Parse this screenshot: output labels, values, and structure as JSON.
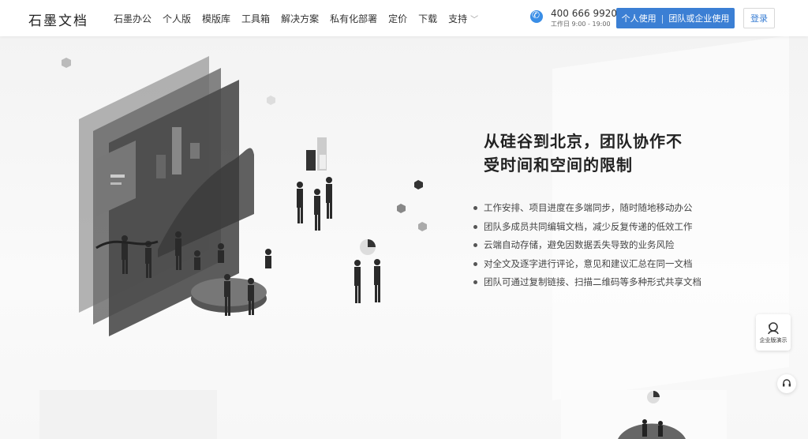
{
  "header": {
    "logo": "石墨文档",
    "nav": [
      {
        "label": "石墨办公"
      },
      {
        "label": "个人版"
      },
      {
        "label": "模版库"
      },
      {
        "label": "工具箱"
      },
      {
        "label": "解决方案"
      },
      {
        "label": "私有化部署"
      },
      {
        "label": "定价"
      },
      {
        "label": "下载"
      },
      {
        "label": "支持"
      }
    ],
    "phone": "400 666 9920",
    "hours": "工作日 9:00 - 19:00",
    "cta_personal": "个人使用",
    "cta_team": "团队或企业使用",
    "login": "登录"
  },
  "hero": {
    "headline_line1": "从硅谷到北京，团队协作不",
    "headline_line2": "受时间和空间的限制",
    "features": [
      "工作安排、项目进度在多端同步，随时随地移动办公",
      "团队多成员共同编辑文档，减少反复传递的低效工作",
      "云端自动存储，避免因数据丢失导致的业务风险",
      "对全文及逐字进行评论，意见和建议汇总在同一文档",
      "团队可通过复制链接、扫描二维码等多种形式共享文档"
    ]
  },
  "floating": {
    "demo_label": "企业版演示"
  },
  "icons": {
    "phone": "phone-icon",
    "chevron": "chevron-down-icon",
    "demo": "customer-service-icon",
    "help": "headset-icon"
  },
  "colors": {
    "brand_blue": "#3b7fd4",
    "text": "#333333"
  }
}
